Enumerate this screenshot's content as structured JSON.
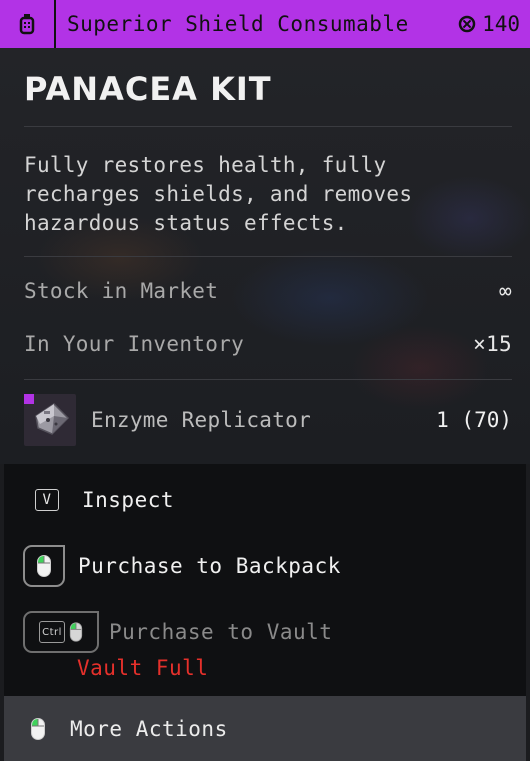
{
  "header": {
    "category": "Superior Shield Consumable",
    "price": "140",
    "bg_color": "#b233e6",
    "category_icon": "consumable-icon",
    "currency_icon": "currency-icon"
  },
  "item": {
    "name": "PANACEA KIT",
    "description": "Fully restores health, fully recharges shields, and removes hazardous status effects."
  },
  "stats": [
    {
      "label": "Stock in Market",
      "value": "∞"
    },
    {
      "label": "In Your Inventory",
      "value": "×15"
    }
  ],
  "ingredient": {
    "name": "Enzyme Replicator",
    "quantity": "1 (70)",
    "rarity_color": "#b233e6"
  },
  "actions": {
    "inspect": {
      "key": "V",
      "label": "Inspect"
    },
    "purchase_backpack": {
      "label": "Purchase to Backpack"
    },
    "purchase_vault": {
      "key": "Ctrl",
      "label": "Purchase to Vault",
      "status": "Vault Full",
      "status_color": "#e5302b"
    },
    "more": {
      "label": "More Actions"
    }
  }
}
